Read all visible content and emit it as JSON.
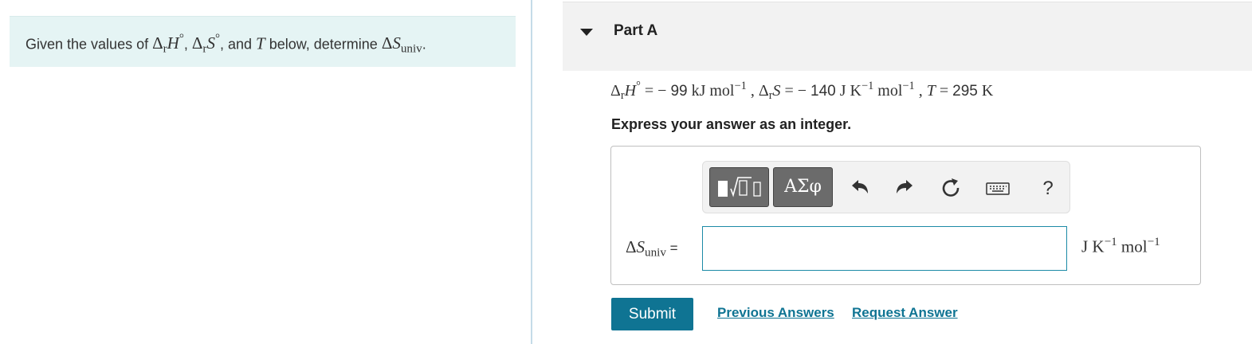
{
  "intro": {
    "prefix": "Given the values of ",
    "dh_delta": "Δ",
    "dh_sub": "r",
    "dh_var": "H",
    "dh_deg": "°",
    "sep1": ", ",
    "ds_delta": "Δ",
    "ds_sub": "r",
    "ds_var": "S",
    "ds_deg": "°",
    "sep2": ", and ",
    "t_var": "T",
    "middle": " below, determine ",
    "su_delta": "Δ",
    "su_var": "S",
    "su_sub": "univ",
    "end": "."
  },
  "part": {
    "title": "Part A"
  },
  "given": {
    "dh_delta": "Δ",
    "dh_sub": "r",
    "dh_var": "H",
    "dh_deg": "°",
    "dh_eq": " = − ",
    "dh_value": "99",
    "dh_unit": " kJ mol",
    "dh_exp": "−1",
    "sep1": " , ",
    "ds_delta": "Δ",
    "ds_sub": "r",
    "ds_var": "S",
    "ds_eq": " = − ",
    "ds_value": "140",
    "ds_unit1": " J K",
    "ds_exp1": "−1",
    "ds_unit2": " mol",
    "ds_exp2": "−1",
    "sep2": " , ",
    "t_var": "T",
    "t_eq": " = ",
    "t_value": "295",
    "t_unit": " K"
  },
  "instruction": "Express your answer as an integer.",
  "toolbar": {
    "greek_label": "ΑΣφ",
    "help_label": "?"
  },
  "answer": {
    "lhs_delta": "Δ",
    "lhs_var": "S",
    "lhs_sub": "univ",
    "lhs_eq": " =",
    "input_value": "",
    "unit1": "J K",
    "unit_exp1": "−1",
    "unit2": " mol",
    "unit_exp2": "−1"
  },
  "actions": {
    "submit_label": "Submit",
    "previous_label": "Previous Answers",
    "request_label": "Request Answer"
  },
  "colors": {
    "accent": "#0f7493",
    "intro_bg": "#e5f4f4",
    "header_bg": "#f2f2f2"
  }
}
